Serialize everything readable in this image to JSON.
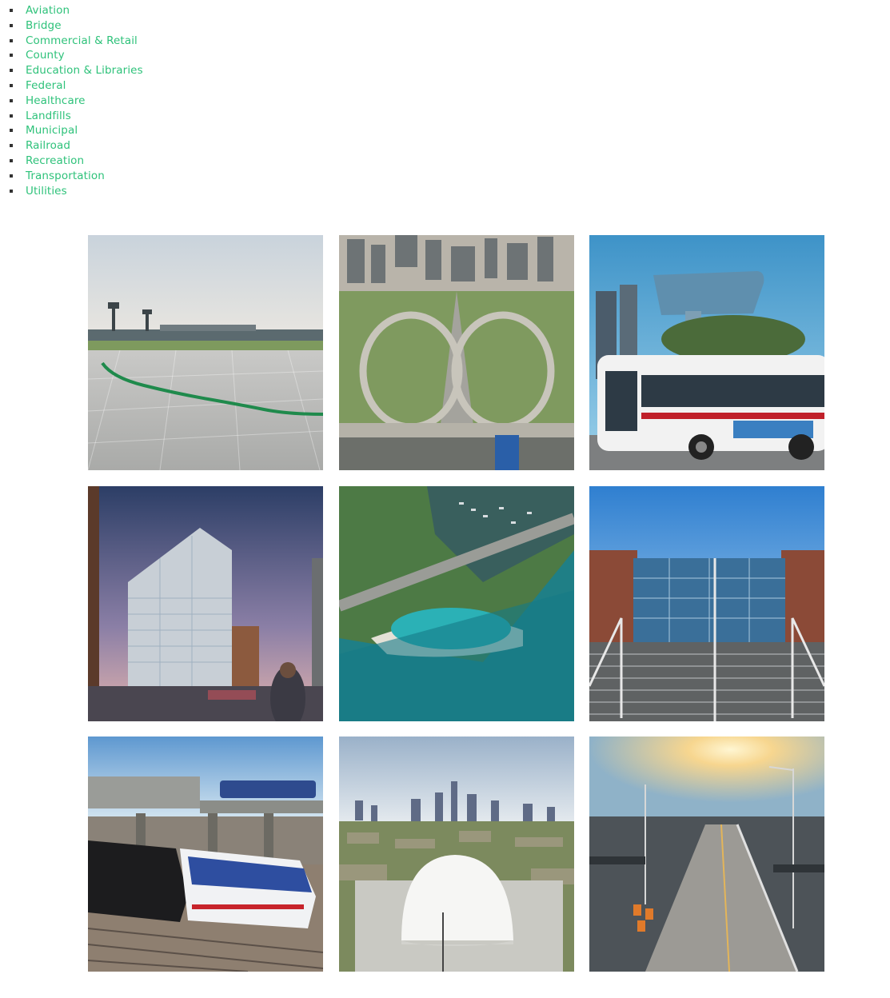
{
  "categories": [
    "Aviation",
    "Bridge",
    "Commercial & Retail",
    "County",
    "Education & Libraries",
    "Federal",
    "Healthcare",
    "Landfills",
    "Municipal",
    "Railroad",
    "Recreation",
    "Transportation",
    "Utilities"
  ],
  "colors": {
    "link": "#2ec27a",
    "bullet": "#333333"
  },
  "gallery": [
    {
      "subject": "airport-runway"
    },
    {
      "subject": "highway-interchange"
    },
    {
      "subject": "city-bus-station"
    },
    {
      "subject": "apartment-tower"
    },
    {
      "subject": "lakefront-harbor"
    },
    {
      "subject": "building-entrance-stairs"
    },
    {
      "subject": "trains-at-rail-yard"
    },
    {
      "subject": "dome-and-city-skyline"
    },
    {
      "subject": "bridge-at-sunset"
    }
  ]
}
